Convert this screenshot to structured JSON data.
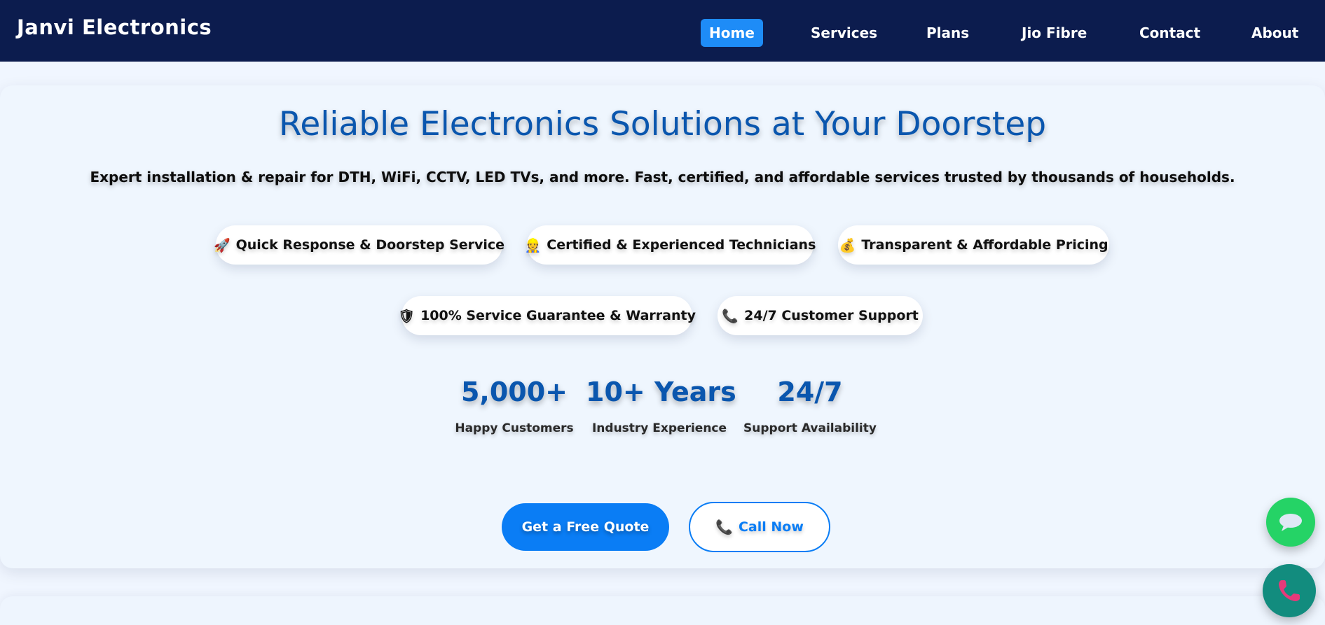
{
  "brand": "Janvi Electronics",
  "nav": [
    {
      "label": "Home",
      "active": true
    },
    {
      "label": "Services",
      "active": false
    },
    {
      "label": "Plans",
      "active": false
    },
    {
      "label": "Jio Fibre",
      "active": false
    },
    {
      "label": "Contact",
      "active": false
    },
    {
      "label": "About",
      "active": false
    }
  ],
  "hero": {
    "title": "Reliable Electronics Solutions at Your Doorstep",
    "subtitle": "Expert installation & repair for DTH, WiFi, CCTV, LED TVs, and more. Fast, certified, and affordable services trusted by thousands of households."
  },
  "features": [
    {
      "icon": "rocket-icon",
      "glyph": "🚀",
      "label": "Quick Response & Doorstep Service"
    },
    {
      "icon": "technician-icon",
      "glyph": "👷",
      "label": "Certified & Experienced Technicians"
    },
    {
      "icon": "money-bag-icon",
      "glyph": "💰",
      "label": "Transparent & Affordable Pricing"
    },
    {
      "icon": "shield-icon",
      "glyph": "🛡",
      "label": "100% Service Guarantee & Warranty"
    },
    {
      "icon": "phone-icon",
      "glyph": "📞",
      "label": "24/7 Customer Support"
    }
  ],
  "stats": [
    {
      "value": "5,000+",
      "label": "Happy Customers"
    },
    {
      "value": "10+ Years",
      "label": "Industry Experience"
    },
    {
      "value": "24/7",
      "label": "Support Availability"
    }
  ],
  "cta": {
    "quote_label": "Get a Free Quote",
    "call_icon": "📞",
    "call_label": "Call Now"
  },
  "floating": {
    "chat_icon": "chat-bubble-icon",
    "call_icon": "phone-handset-icon"
  },
  "colors": {
    "navbar": "#0c1c4e",
    "accent": "#0a7df5",
    "title": "#0a56ae",
    "active_nav": "#1e8cf7",
    "whatsapp": "#25d366",
    "call_fab": "#128c7e"
  }
}
